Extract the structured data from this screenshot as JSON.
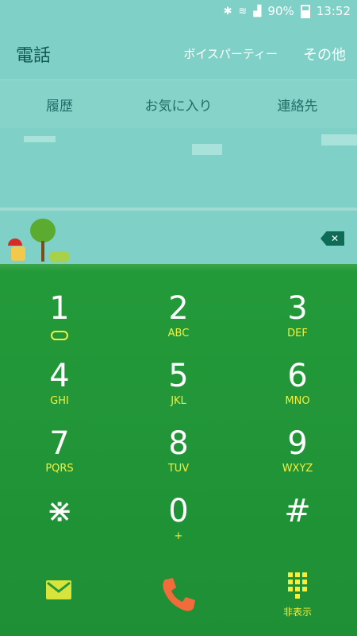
{
  "status": {
    "battery": "90%",
    "time": "13:52"
  },
  "header": {
    "title": "電話",
    "voice_party": "ボイスパーティー",
    "more": "その他"
  },
  "tabs": [
    {
      "label": "履歴"
    },
    {
      "label": "お気に入り"
    },
    {
      "label": "連絡先"
    }
  ],
  "keypad": [
    {
      "num": "1",
      "letters": ""
    },
    {
      "num": "2",
      "letters": "ABC"
    },
    {
      "num": "3",
      "letters": "DEF"
    },
    {
      "num": "4",
      "letters": "GHI"
    },
    {
      "num": "5",
      "letters": "JKL"
    },
    {
      "num": "6",
      "letters": "MNO"
    },
    {
      "num": "7",
      "letters": "PQRS"
    },
    {
      "num": "8",
      "letters": "TUV"
    },
    {
      "num": "9",
      "letters": "WXYZ"
    },
    {
      "num": "⋇",
      "letters": ""
    },
    {
      "num": "0",
      "letters": "+"
    },
    {
      "num": "#",
      "letters": ""
    }
  ],
  "bottom": {
    "hide_label": "非表示"
  },
  "colors": {
    "header_bg": "#7fd0c7",
    "grass": "#239a3a",
    "accent_yellow": "#f5ef3a",
    "call_orange": "#f26b3a"
  }
}
